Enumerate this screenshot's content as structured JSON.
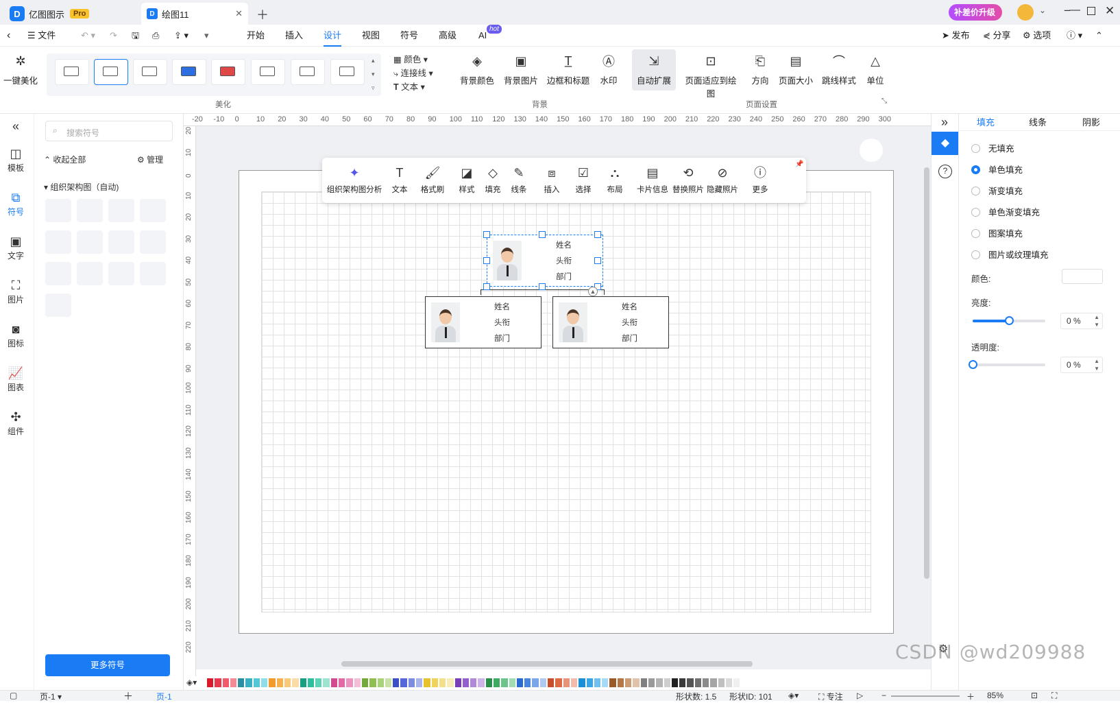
{
  "titlebar": {
    "app_name": "亿图图示",
    "pro_badge": "Pro",
    "doc_tab": "绘图11",
    "upgrade": "补差价升级"
  },
  "menubar": {
    "file": "文件",
    "items": [
      "开始",
      "插入",
      "设计",
      "视图",
      "符号",
      "高级",
      "AI"
    ],
    "active": "设计",
    "ai_badge": "hot",
    "publish": "发布",
    "share": "分享",
    "options": "选项"
  },
  "ribbon": {
    "beautify": "一键美化",
    "theme_group": "美化",
    "color": "颜色",
    "connector": "连接线",
    "text": "文本",
    "bg_color": "背景颜色",
    "bg_image": "背景图片",
    "border_title": "边框和标题",
    "watermark": "水印",
    "bg_group": "背景",
    "auto_expand": "自动扩展",
    "fit_page": "页面适应到绘图",
    "orientation": "方向",
    "page_size": "页面大小",
    "jump_style": "跳线样式",
    "unit": "单位",
    "page_group": "页面设置",
    "theme_colors": [
      "#ffffff",
      "#ffffff",
      "#ffffff",
      "#2b6fe0",
      "#e04848",
      "#ffffff",
      "#ffffff",
      "#ffffff"
    ]
  },
  "leftnav": {
    "items": [
      "模板",
      "符号",
      "文字",
      "图片",
      "图标",
      "图表",
      "组件"
    ],
    "active": "符号"
  },
  "leftpanel": {
    "search_placeholder": "搜索符号",
    "collapse_all": "收起全部",
    "manage": "管理",
    "category": "组织架构图（自动)",
    "more_button": "更多符号"
  },
  "ruler": {
    "top": [
      "-20",
      "-10",
      "0",
      "10",
      "20",
      "30",
      "40",
      "50",
      "60",
      "70",
      "80",
      "90",
      "100",
      "110",
      "120",
      "130",
      "140",
      "150",
      "160",
      "170",
      "180",
      "190",
      "200",
      "210",
      "220",
      "230",
      "240",
      "250",
      "260",
      "270",
      "280",
      "290",
      "300"
    ],
    "left": [
      "20",
      "10",
      "0",
      "10",
      "20",
      "30",
      "40",
      "50",
      "60",
      "70",
      "80",
      "90",
      "100",
      "110",
      "120",
      "130",
      "140",
      "150",
      "160",
      "170",
      "180",
      "190",
      "200",
      "210",
      "220"
    ]
  },
  "floatbar": [
    "组织架构图分析",
    "文本",
    "格式刷",
    "样式",
    "填充",
    "线条",
    "插入",
    "选择",
    "布局",
    "卡片信息",
    "替换照片",
    "隐藏照片",
    "更多"
  ],
  "cards": [
    {
      "name": "姓名",
      "title": "头衔",
      "dept": "部门"
    },
    {
      "name": "姓名",
      "title": "头衔",
      "dept": "部门"
    },
    {
      "name": "姓名",
      "title": "头衔",
      "dept": "部门"
    }
  ],
  "rightpanel": {
    "tabs": [
      "填充",
      "线条",
      "阴影"
    ],
    "active_tab": "填充",
    "options": [
      "无填充",
      "单色填充",
      "渐变填充",
      "单色渐变填充",
      "图案填充",
      "图片或纹理填充"
    ],
    "selected": "单色填充",
    "color_label": "颜色:",
    "brightness_label": "亮度:",
    "brightness_value": "0 %",
    "brightness_level": 0.5,
    "transparency_label": "透明度:",
    "transparency_value": "0 %",
    "transparency_level": 0
  },
  "palette": [
    "#d91a2a",
    "#e63a4c",
    "#ef5b6b",
    "#f38a96",
    "#2a8fa0",
    "#3ab1c3",
    "#52c7d6",
    "#8fdde6",
    "#f29a2e",
    "#f6b04d",
    "#f9c97a",
    "#fbdca6",
    "#1aa080",
    "#2fbf9c",
    "#5fd3b6",
    "#9ae4d0",
    "#d34a8f",
    "#e36aa7",
    "#ec93c0",
    "#f4bdd8",
    "#73a83a",
    "#8fc04f",
    "#aad27a",
    "#c8e2a6",
    "#3b4fc7",
    "#5468da",
    "#7c8ce3",
    "#aab4ee",
    "#e8c22e",
    "#efd35b",
    "#f4e08a",
    "#f8ecb8",
    "#7a3fb8",
    "#9460cc",
    "#b08ad9",
    "#cdb3e8",
    "#2a8f4a",
    "#3faa62",
    "#6cc48a",
    "#a2dcb3",
    "#2a6bd0",
    "#4a86e0",
    "#7aa6ea",
    "#aecaf4",
    "#c84d2a",
    "#dd6a45",
    "#e9927a",
    "#f2bbab",
    "#1a8fd8",
    "#3aa6e6",
    "#6fc0ee",
    "#a6daf6",
    "#9a5a2a",
    "#b57746",
    "#cc9c76",
    "#e0c3a8",
    "#808080",
    "#9a9a9a",
    "#b4b4b4",
    "#cecece",
    "#222222",
    "#3a3a3a",
    "#555555",
    "#707070",
    "#8a8a8a",
    "#a5a5a5",
    "#c0c0c0",
    "#dadada",
    "#f0f0f0"
  ],
  "statusbar": {
    "page_label": "页-1",
    "page_tab": "页-1",
    "shape_count": "形状数: 1.5",
    "shape_id": "形状ID: 101",
    "focus": "专注",
    "zoom": "85%"
  },
  "watermark": "CSDN @wd209988"
}
